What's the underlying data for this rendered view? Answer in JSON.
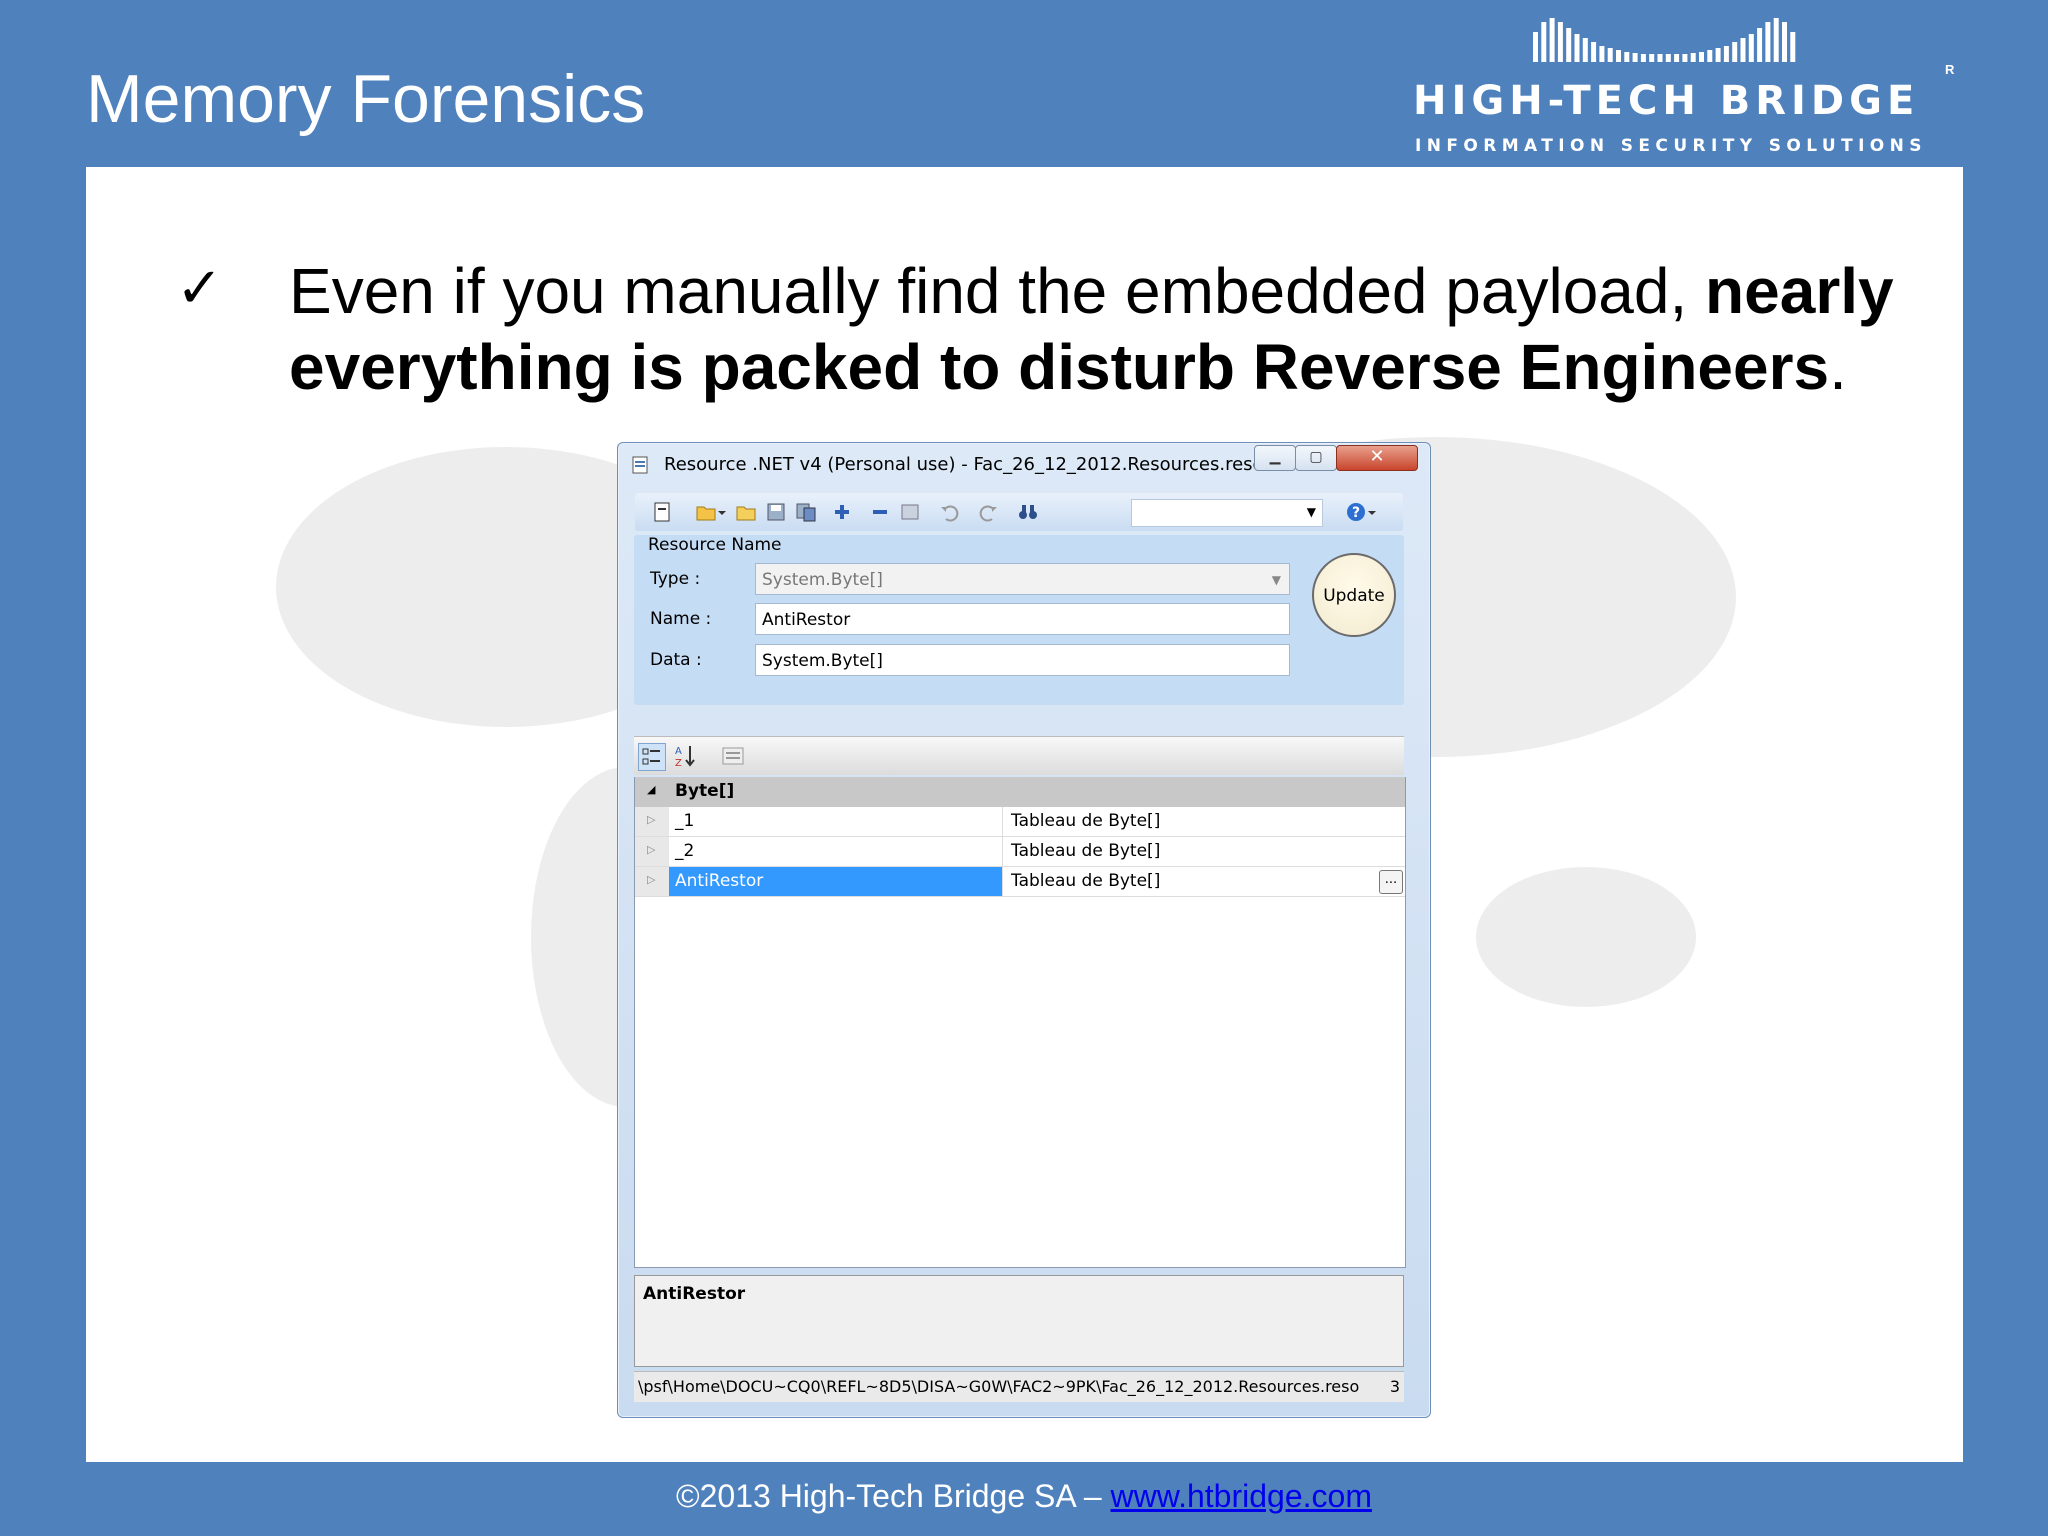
{
  "slide": {
    "title": "Memory Forensics",
    "bullet_plain": "Even if you manually find the embedded payload, ",
    "bullet_bold": "nearly everything is packed to disturb Reverse Engineers",
    "bullet_end": ".",
    "footer_prefix": "©2013 High-Tech Bridge SA – ",
    "footer_link": "www.htbridge.com"
  },
  "logo": {
    "name": "HIGH-TECH BRIDGE",
    "tagline": "INFORMATION SECURITY SOLUTIONS",
    "registered": "R"
  },
  "window": {
    "title": "Resource .NET v4 (Personal  use) - Fac_26_12_2012.Resources.reso...",
    "min_icon": "minimize-icon",
    "max_icon": "maximize-icon",
    "close_icon": "close-icon",
    "close_glyph": "✕",
    "resource_name_label": "Resource Name",
    "type_label": "Type :",
    "type_value": "System.Byte[]",
    "name_label": "Name :",
    "name_value": "AntiRestor",
    "data_label": "Data :",
    "data_value": "System.Byte[]",
    "update_label": "Update",
    "category": "Byte[]",
    "rows": [
      {
        "name": "_1",
        "value": "Tableau de Byte[]"
      },
      {
        "name": "_2",
        "value": "Tableau de Byte[]"
      },
      {
        "name": "AntiRestor",
        "value": "Tableau de Byte[]"
      }
    ],
    "ellipsis": "...",
    "description_title": "AntiRestor",
    "status_path": "\\psf\\Home\\DOCU~CQ0\\REFL~8D5\\DISA~G0W\\FAC2~9PK\\Fac_26_12_2012.Resources.reso",
    "status_count": "3"
  },
  "colors": {
    "background": "#4f81bd",
    "selection": "#3399ff"
  }
}
